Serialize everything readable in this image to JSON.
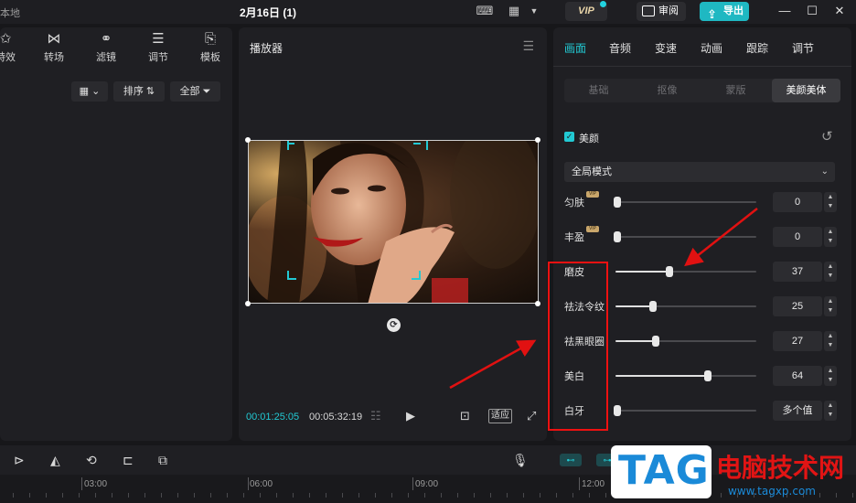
{
  "titlebar": {
    "local_label": "本地",
    "project_title": "2月16日 (1)",
    "vip_label": "VIP",
    "review_label": "审阅",
    "export_label": "导出"
  },
  "left_panel": {
    "tabs": [
      {
        "label": "特效",
        "icon": "sparkle-icon"
      },
      {
        "label": "转场",
        "icon": "bowtie-icon"
      },
      {
        "label": "滤镜",
        "icon": "filter-icon"
      },
      {
        "label": "调节",
        "icon": "sliders-icon"
      },
      {
        "label": "模板",
        "icon": "template-icon"
      }
    ],
    "sort_label": "排序",
    "all_label": "全部"
  },
  "player": {
    "title": "播放器",
    "current_time": "00:01:25:05",
    "total_time": "00:05:32:19",
    "fit_label": "适应"
  },
  "right_panel": {
    "tabs": [
      "画面",
      "音频",
      "变速",
      "动画",
      "跟踪",
      "调节"
    ],
    "active_tab": "画面",
    "subtabs": [
      "基础",
      "抠像",
      "蒙版",
      "美颜美体"
    ],
    "active_subtab": "美颜美体",
    "beauty_label": "美颜",
    "beauty_checked": true,
    "mode_value": "全局模式",
    "sliders": [
      {
        "label": "匀肤",
        "value": "0",
        "vip": true,
        "fraction": 0.0
      },
      {
        "label": "丰盈",
        "value": "0",
        "vip": true,
        "fraction": 0.0
      },
      {
        "label": "磨皮",
        "value": "37",
        "vip": false,
        "fraction": 0.37
      },
      {
        "label": "祛法令纹",
        "value": "25",
        "vip": false,
        "fraction": 0.25
      },
      {
        "label": "祛黑眼圈",
        "value": "27",
        "vip": false,
        "fraction": 0.27
      },
      {
        "label": "美白",
        "value": "64",
        "vip": false,
        "fraction": 0.64
      },
      {
        "label": "白牙",
        "value": "多个值",
        "vip": false,
        "fraction": 0.0
      }
    ]
  },
  "timeline": {
    "ruler_labels": [
      "03:00",
      "06:00",
      "09:00",
      "12:00"
    ]
  },
  "watermark": {
    "tag": "TAG",
    "site_name": "电脑技术网",
    "url": "www.tagxp.com"
  },
  "colors": {
    "accent": "#22c9d3",
    "annotation_red": "#e11111"
  }
}
